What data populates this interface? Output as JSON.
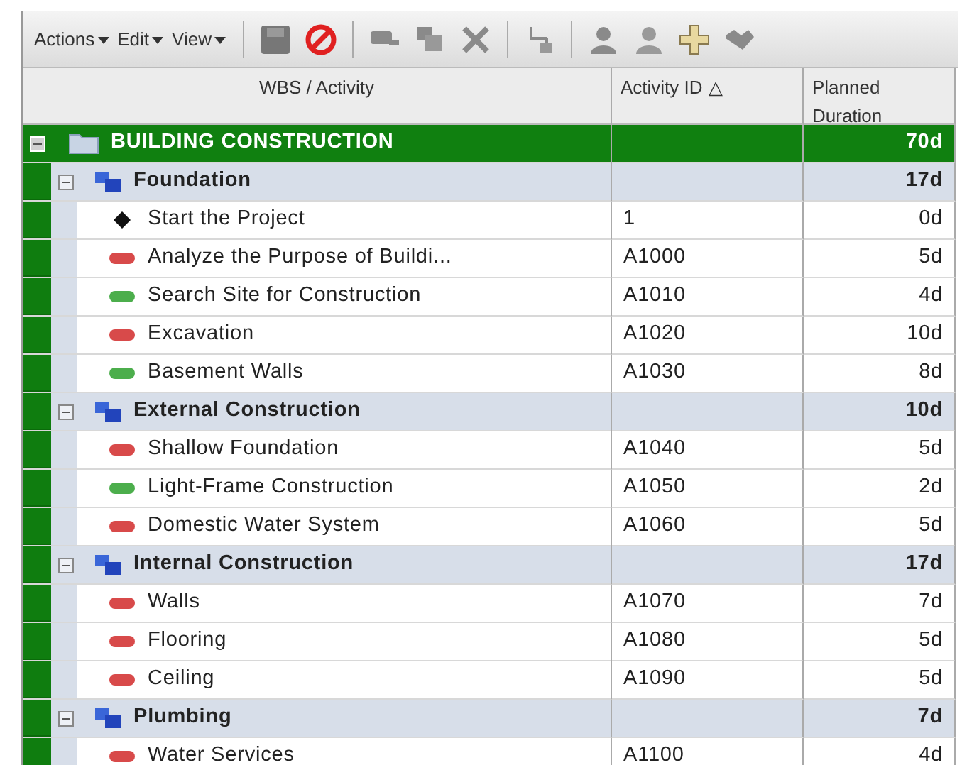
{
  "toolbar": {
    "menus": [
      {
        "label": "Actions"
      },
      {
        "label": "Edit"
      },
      {
        "label": "View"
      }
    ]
  },
  "columns": [
    {
      "label": "WBS / Activity"
    },
    {
      "label": "Activity ID",
      "sort_mark": "△"
    },
    {
      "label": "Planned Duration"
    }
  ],
  "tree": {
    "name": "BUILDING CONSTRUCTION",
    "duration": "70d",
    "expanded": true,
    "children": [
      {
        "name": "Foundation",
        "duration": "17d",
        "expanded": true,
        "children": [
          {
            "kind": "milestone",
            "name": "Start the Project",
            "id": "1",
            "duration": "0d"
          },
          {
            "kind": "task",
            "color": "#d84a4a",
            "name": "Analyze the Purpose of Buildi...",
            "id": "A1000",
            "duration": "5d"
          },
          {
            "kind": "task",
            "color": "#4cae4c",
            "name": "Search Site for Construction",
            "id": "A1010",
            "duration": "4d"
          },
          {
            "kind": "task",
            "color": "#d84a4a",
            "name": "Excavation",
            "id": "A1020",
            "duration": "10d"
          },
          {
            "kind": "task",
            "color": "#4cae4c",
            "name": "Basement Walls",
            "id": "A1030",
            "duration": "8d"
          }
        ]
      },
      {
        "name": "External Construction",
        "duration": "10d",
        "expanded": true,
        "children": [
          {
            "kind": "task",
            "color": "#d84a4a",
            "name": "Shallow Foundation",
            "id": "A1040",
            "duration": "5d"
          },
          {
            "kind": "task",
            "color": "#4cae4c",
            "name": "Light-Frame Construction",
            "id": "A1050",
            "duration": "2d"
          },
          {
            "kind": "task",
            "color": "#d84a4a",
            "name": "Domestic Water System",
            "id": "A1060",
            "duration": "5d"
          }
        ]
      },
      {
        "name": "Internal Construction",
        "duration": "17d",
        "expanded": true,
        "children": [
          {
            "kind": "task",
            "color": "#d84a4a",
            "name": "Walls",
            "id": "A1070",
            "duration": "7d"
          },
          {
            "kind": "task",
            "color": "#d84a4a",
            "name": "Flooring",
            "id": "A1080",
            "duration": "5d"
          },
          {
            "kind": "task",
            "color": "#d84a4a",
            "name": "Ceiling",
            "id": "A1090",
            "duration": "5d"
          }
        ]
      },
      {
        "name": "Plumbing",
        "duration": "7d",
        "expanded": true,
        "children": [
          {
            "kind": "task",
            "color": "#d84a4a",
            "name": "Water Services",
            "id": "A1100",
            "duration": "4d"
          }
        ]
      }
    ]
  }
}
